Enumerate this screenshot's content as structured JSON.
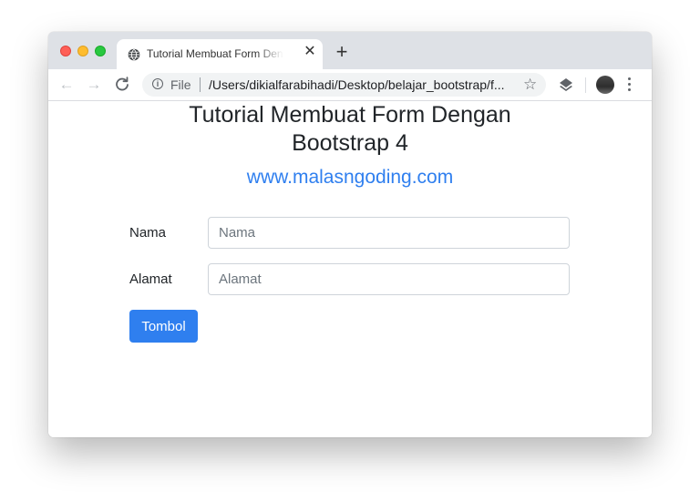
{
  "browser": {
    "tab_title": "Tutorial Membuat Form Dengan Bootstrap 4",
    "tab_close": "✕",
    "new_tab": "+",
    "nav": {
      "back": "←",
      "forward": "→",
      "reload": "C"
    },
    "address": {
      "info_icon": "i",
      "scheme_label": "File",
      "url": "/Users/dikialfarabihadi/Desktop/belajar_bootstrap/f..."
    },
    "bookmark_star": "☆",
    "icons": [
      "globe-icon",
      "arrow-left-icon",
      "arrow-right-icon",
      "reload-icon",
      "info-icon",
      "star-icon",
      "layers-icon",
      "avatar",
      "more-vert-icon"
    ]
  },
  "page": {
    "title_line1": "Tutorial Membuat Form Dengan",
    "title_line2": "Bootstrap 4",
    "subtitle": "www.malasngoding.com",
    "form": {
      "fields": [
        {
          "label": "Nama",
          "placeholder": "Nama",
          "value": ""
        },
        {
          "label": "Alamat",
          "placeholder": "Alamat",
          "value": ""
        }
      ],
      "button_label": "Tombol"
    }
  },
  "colors": {
    "primary": "#2f7fef",
    "tabbar": "#dee1e6",
    "text": "#212529"
  }
}
